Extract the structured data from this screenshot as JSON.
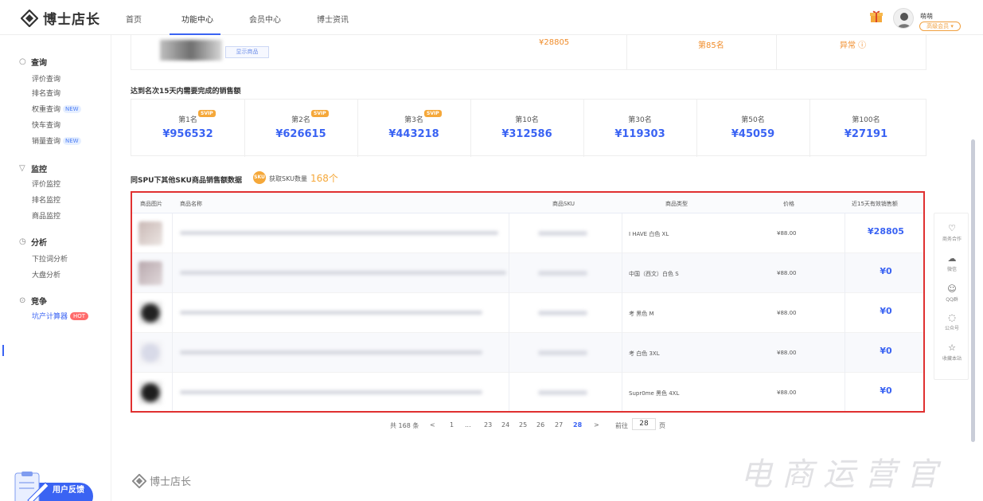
{
  "brand": {
    "name": "博士店长",
    "accent": "#3a63f3",
    "orange": "#f08c2a"
  },
  "nav": {
    "items": [
      {
        "label": "首页"
      },
      {
        "label": "功能中心"
      },
      {
        "label": "会员中心"
      },
      {
        "label": "博士资讯"
      }
    ],
    "active_index": 1
  },
  "user": {
    "name": "萌萌",
    "member_label": "高级会员 ▾"
  },
  "sidebar": {
    "groups": [
      {
        "label": "查询",
        "icon": "search-icon",
        "items": [
          {
            "label": "评价查询",
            "tag": ""
          },
          {
            "label": "排名查询",
            "tag": ""
          },
          {
            "label": "权重查询",
            "tag": "NEW"
          },
          {
            "label": "快车查询",
            "tag": ""
          },
          {
            "label": "销量查询",
            "tag": "NEW"
          }
        ]
      },
      {
        "label": "监控",
        "icon": "monitor-icon",
        "items": [
          {
            "label": "评价监控",
            "tag": ""
          },
          {
            "label": "排名监控",
            "tag": ""
          },
          {
            "label": "商品监控",
            "tag": ""
          }
        ]
      },
      {
        "label": "分析",
        "icon": "clock-icon",
        "items": [
          {
            "label": "下拉词分析",
            "tag": ""
          },
          {
            "label": "大盘分析",
            "tag": ""
          }
        ]
      },
      {
        "label": "竞争",
        "icon": "compete-icon",
        "items": [
          {
            "label": "坑产计算器",
            "tag": "HOT"
          }
        ]
      }
    ],
    "feedback_label": "用户反馈"
  },
  "top_card": {
    "show_button": "显示商品",
    "amount": "¥28805",
    "rank": "第85名",
    "status": "异常 ⓘ"
  },
  "rank_section": {
    "title": "达到名次15天内需要完成的销售额",
    "vip_badge": "SVIP",
    "ranks": [
      {
        "label": "第1名",
        "value": "¥956532",
        "vip": true
      },
      {
        "label": "第2名",
        "value": "¥626615",
        "vip": true
      },
      {
        "label": "第3名",
        "value": "¥443218",
        "vip": true
      },
      {
        "label": "第10名",
        "value": "¥312586",
        "vip": false
      },
      {
        "label": "第30名",
        "value": "¥119303",
        "vip": false
      },
      {
        "label": "第50名",
        "value": "¥45059",
        "vip": false
      },
      {
        "label": "第100名",
        "value": "¥27191",
        "vip": false
      }
    ]
  },
  "sku_section": {
    "title": "同SPU下其他SKU商品销售额数据",
    "badge": "SKU",
    "count_label": "获取SKU数量",
    "count": "168个"
  },
  "table": {
    "columns": [
      "商品图片",
      "商品名称",
      "商品SKU",
      "商品类型",
      "价格",
      "近15天有效销售额"
    ],
    "rows": [
      {
        "type": "I HAVE 白色  XL",
        "price": "¥88.00",
        "sales": "¥28805"
      },
      {
        "type": "中国（西文）白色  S",
        "price": "¥88.00",
        "sales": "¥0"
      },
      {
        "type": "考 黑色  M",
        "price": "¥88.00",
        "sales": "¥0"
      },
      {
        "type": "考 白色  3XL",
        "price": "¥88.00",
        "sales": "¥0"
      },
      {
        "type": "Supr0me 黑色  4XL",
        "price": "¥88.00",
        "sales": "¥0"
      }
    ]
  },
  "pagination": {
    "total": "共 168 条",
    "prev": "<",
    "next": ">",
    "pages": [
      "1",
      "...",
      "23",
      "24",
      "25",
      "26",
      "27",
      "28"
    ],
    "current": "28",
    "goto_label": "前往",
    "goto_value": "28",
    "goto_unit": "页"
  },
  "float_bar": [
    {
      "icon": "handshake-icon",
      "glyph": "♡",
      "label": "商务合作"
    },
    {
      "icon": "wechat-icon",
      "glyph": "☁",
      "label": "微信"
    },
    {
      "icon": "qq-icon",
      "glyph": "☺",
      "label": "QQ群"
    },
    {
      "icon": "chat-icon",
      "glyph": "◌",
      "label": "公众号"
    },
    {
      "icon": "star-icon",
      "glyph": "☆",
      "label": "收藏本站"
    }
  ],
  "footer": {
    "brand": "博士店长"
  },
  "watermark": "电商运营官"
}
